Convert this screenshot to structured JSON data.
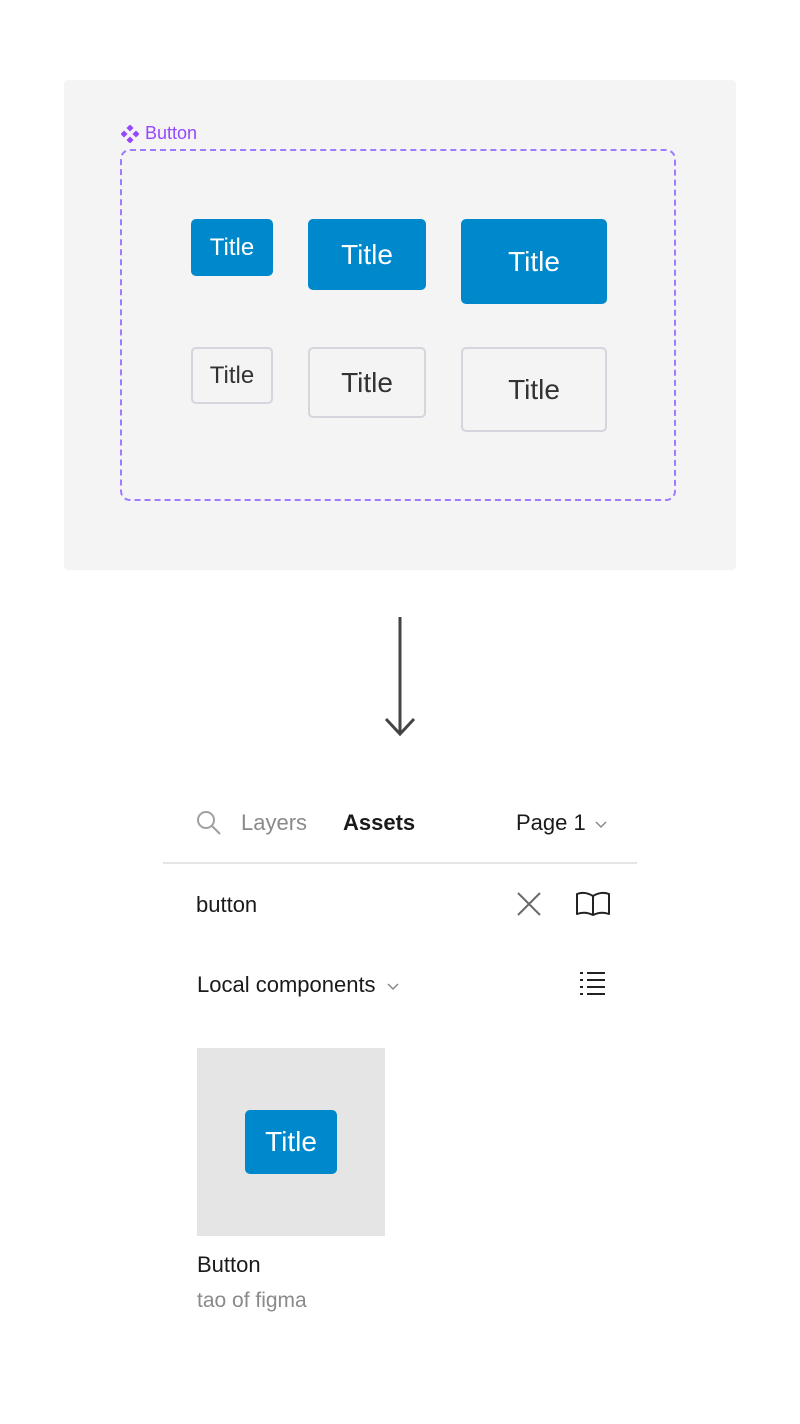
{
  "canvas": {
    "component_name": "Button",
    "variants": [
      {
        "label": "Title",
        "style": "primary",
        "size": "small"
      },
      {
        "label": "Title",
        "style": "primary",
        "size": "medium"
      },
      {
        "label": "Title",
        "style": "primary",
        "size": "large"
      },
      {
        "label": "Title",
        "style": "secondary",
        "size": "small"
      },
      {
        "label": "Title",
        "style": "secondary",
        "size": "medium"
      },
      {
        "label": "Title",
        "style": "secondary",
        "size": "large"
      }
    ]
  },
  "panel": {
    "tabs": {
      "layers": "Layers",
      "assets": "Assets"
    },
    "page": "Page 1",
    "search_value": "button",
    "library_filter": "Local components",
    "asset": {
      "preview_label": "Title",
      "name": "Button",
      "library": "tao of figma"
    }
  },
  "colors": {
    "primary": "#0088cc",
    "component_purple": "#9747ff",
    "secondary_border": "#d5d5dd"
  },
  "icons": [
    "component-icon",
    "down-arrow-icon",
    "search-icon",
    "chevron-down-icon",
    "close-icon",
    "book-icon",
    "list-view-icon"
  ]
}
